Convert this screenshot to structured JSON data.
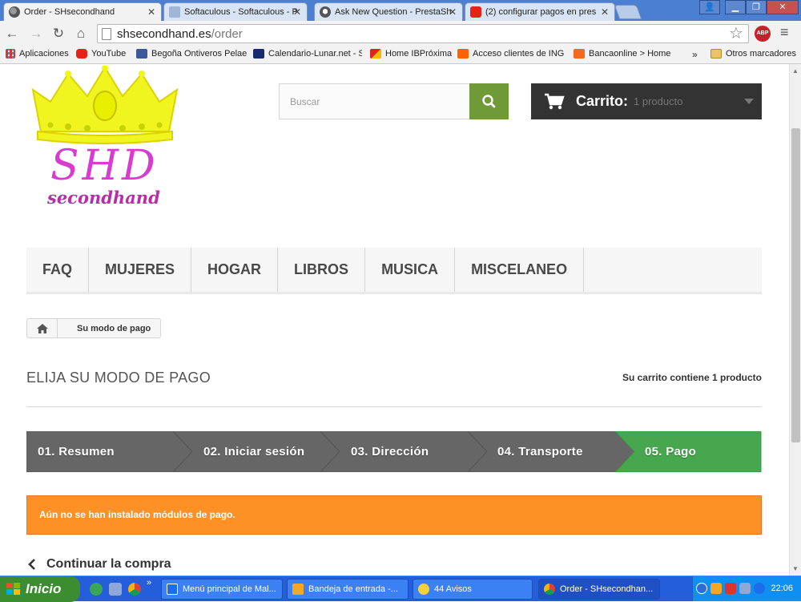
{
  "browser": {
    "tabs": [
      {
        "label": "Order - SHsecondhand",
        "active": true,
        "icon": "globe-icon"
      },
      {
        "label": "Softaculous - Softaculous - P",
        "active": false,
        "icon": "softaculous-icon"
      },
      {
        "label": "Ask New Question - PrestaSh",
        "active": false,
        "icon": "prestashop-icon"
      },
      {
        "label": "(2) configurar pagos en pres",
        "active": false,
        "icon": "youtube-icon"
      }
    ],
    "url_host": "shsecondhand.es",
    "url_path": "/order",
    "abp_label": "ABP",
    "bookmarks": [
      {
        "label": "Aplicaciones",
        "icon": "apps-icon"
      },
      {
        "label": "YouTube",
        "icon": "youtube-icon"
      },
      {
        "label": "Begoña Ontiveros Pelae",
        "icon": "facebook-icon"
      },
      {
        "label": "Calendario-Lunar.net - S",
        "icon": "moon-icon"
      },
      {
        "label": "Home IBPróxima",
        "icon": "iberia-icon"
      },
      {
        "label": "Acceso clientes de ING D",
        "icon": "ing-icon"
      },
      {
        "label": "Bancaonline > Home",
        "icon": "bk-icon"
      }
    ],
    "bookmarks_overflow": "»",
    "other_bookmarks": "Otros marcadores"
  },
  "site": {
    "logo_text": "SHD",
    "logo_sub": "secondhand",
    "search_placeholder": "Buscar",
    "cart_label": "Carrito:",
    "cart_count": "1 producto",
    "menu": [
      "FAQ",
      "MUJERES",
      "HOGAR",
      "LIBROS",
      "MUSICA",
      "MISCELANEO"
    ],
    "breadcrumb": "Su modo de pago",
    "heading": "ELIJA SU MODO DE PAGO",
    "cart_info": "Su carrito contiene 1 producto",
    "steps": [
      {
        "label": "01. Resumen",
        "color": "#666666"
      },
      {
        "label": "02. Iniciar sesión",
        "color": "#666666"
      },
      {
        "label": "03. Dirección",
        "color": "#666666"
      },
      {
        "label": "04. Transporte",
        "color": "#666666"
      },
      {
        "label": "05. Pago",
        "color": "#46a74e"
      }
    ],
    "alert": "Aún no se han instalado módulos de pago.",
    "continue_label": "Continuar la compra"
  },
  "taskbar": {
    "start_label": "Inicio",
    "quicklaunch_overflow": "»",
    "tasks": [
      {
        "label": "Menú principal de Mal...",
        "icon": "mail-icon"
      },
      {
        "label": "Bandeja de entrada -...",
        "icon": "inbox-icon"
      },
      {
        "label": "44 Avisos",
        "icon": "bell-icon"
      },
      {
        "label": "Order - SHsecondhan...",
        "icon": "chrome-icon"
      }
    ],
    "clock": "22:06"
  },
  "colors": {
    "accent_green": "#46a74e",
    "search_green": "#6f9a37",
    "alert_orange": "#fe9126",
    "cart_dark": "#333333",
    "logo_pink": "#d93ad0",
    "crown_yellow": "#f1f51f"
  }
}
